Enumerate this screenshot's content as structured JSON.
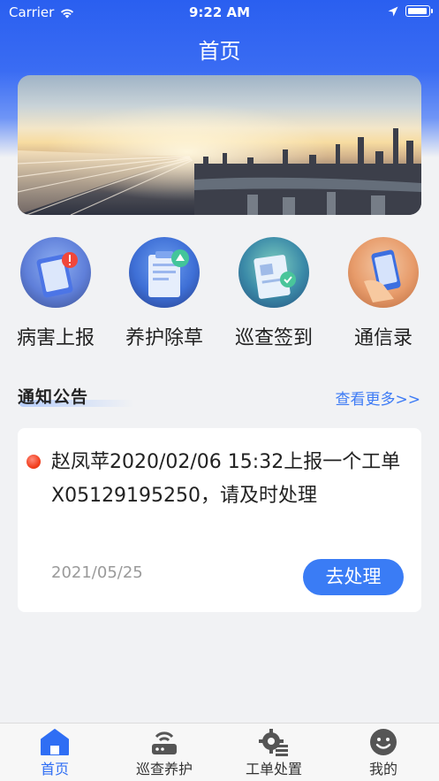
{
  "status_bar": {
    "carrier": "Carrier",
    "time": "9:22 AM"
  },
  "nav": {
    "title": "首页"
  },
  "quick_actions": [
    {
      "label": "病害上报",
      "icon": "tablet-alert-icon"
    },
    {
      "label": "养护除草",
      "icon": "clipboard-icon"
    },
    {
      "label": "巡查签到",
      "icon": "checkin-clipboard-icon"
    },
    {
      "label": "通信录",
      "icon": "phone-hand-icon"
    }
  ],
  "notice": {
    "section_title": "通知公告",
    "more_label": "查看更多>>",
    "item": {
      "text": "赵凤苹2020/02/06 15:32上报一个工单X05129195250，请及时处理",
      "date": "2021/05/25",
      "action_label": "去处理"
    }
  },
  "tabs": [
    {
      "label": "首页",
      "icon": "home-icon",
      "active": true
    },
    {
      "label": "巡查养护",
      "icon": "router-icon",
      "active": false
    },
    {
      "label": "工单处置",
      "icon": "gear-list-icon",
      "active": false
    },
    {
      "label": "我的",
      "icon": "smiley-icon",
      "active": false
    }
  ],
  "colors": {
    "primary": "#2f6ef4",
    "header": "#2a5ff0",
    "alert": "#f2401f"
  }
}
